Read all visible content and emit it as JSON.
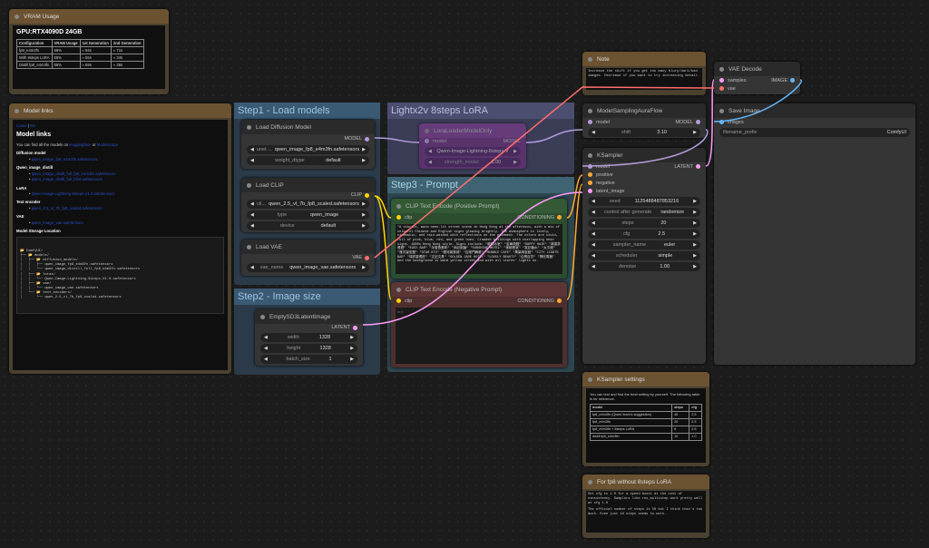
{
  "vram": {
    "title": "VRAM Usage",
    "gpu": "GPU:RTX4090D 24GB",
    "headers": [
      "Configuration",
      "VRAM Usage",
      "1st Generation",
      "2nd Generation"
    ],
    "rows": [
      [
        "fp8_e4m3fn",
        "86%",
        "≈ 94s",
        "≈ 71s"
      ],
      [
        "With 8steps LoRA",
        "86%",
        "≈ 55s",
        "≈ 34s"
      ],
      [
        "Distill fp8_e4m3fn",
        "86%",
        "≈ 69s",
        "≈ 36s"
      ]
    ]
  },
  "links": {
    "title": "Model links",
    "top_links": [
      "Loose",
      "|",
      "BS"
    ],
    "heading": "Model links",
    "intro_prefix": "You can find all the models on ",
    "intro_link1": "Huggingface",
    "intro_or": " or ",
    "intro_link2": "Modelscope",
    "sections": [
      {
        "label": "Diffusion model",
        "items": [
          "qwen_image_fp8_e4m3fn.safetensors"
        ]
      },
      {
        "label": "Qwen_image_distill",
        "items": [
          "qwen_image_distill_full_fp8_e4m3fn.safetensors",
          "qwen_image_distill_full_bf16.safetensors"
        ]
      },
      {
        "label": "LoRA",
        "items": [
          "Qwen-Image-Lightning-8steps-V1.0.safetensors"
        ]
      },
      {
        "label": "Text encoder",
        "items": [
          "qwen_2.5_vl_7b_fp8_scaled.safetensors"
        ]
      },
      {
        "label": "VAE",
        "items": [
          "qwen_image_vae.safetensors"
        ]
      }
    ],
    "storage_label": "Model Storage Location",
    "tree": [
      "📂 ComfyUI/",
      "├── 📂 models/",
      "│   ├── 📂 diffusion_models/",
      "│   │   ├── qwen_image_fp8_e4m3fn.safetensors",
      "│   │   └── qwen_image_distill_full_fp8_e4m3fn.safetensors",
      "│   ├── 📂 loras/",
      "│   │   └── Qwen-Image-Lightning-8steps-V1.0.safetensors",
      "│   ├── 📂 vae/",
      "│   │   └── qwen_image_vae.safetensors",
      "│   └── 📂 text_encoders/",
      "│       └── qwen_2.5_vl_7b_fp8_scaled.safetensors"
    ]
  },
  "groups": {
    "step1": "Step1 - Load models",
    "step2": "Step2 - Image size",
    "step3": "Step3 - Prompt",
    "lightx": "Lightx2v 8steps LoRA"
  },
  "load_diffusion": {
    "title": "Load Diffusion Model",
    "out": "MODEL",
    "unet_label": "unet ...",
    "unet_value": "qwen_image_fp8_e4m3fn.safetensors",
    "dtype_label": "weight_dtype",
    "dtype_value": "default"
  },
  "load_clip": {
    "title": "Load CLIP",
    "out": "CLIP",
    "name_label": "cli...",
    "name_value": "qwen_2.5_vl_7b_fp8_scaled.safetensors",
    "type_label": "type",
    "type_value": "qwen_image",
    "device_label": "device",
    "device_value": "default"
  },
  "load_vae": {
    "title": "Load VAE",
    "out": "VAE",
    "name_label": "vae_name",
    "name_value": "qwen_image_vae.safetensors"
  },
  "empty_latent": {
    "title": "EmptySD3LatentImage",
    "out": "LATENT",
    "width_label": "width",
    "width_value": "1328",
    "height_label": "height",
    "height_value": "1328",
    "batch_label": "batch_size",
    "batch_value": "1"
  },
  "lora": {
    "title": "LoraLoaderModelOnly",
    "in": "model",
    "out": "MODEL",
    "name_value": "Qwen-Image-Lightning-8steps-V",
    "strength_label": "strength_model",
    "strength_value": "1.00"
  },
  "pos": {
    "title": "CLIP Text Encode (Positive Prompt)",
    "in": "clip",
    "out": "CONDITIONING",
    "text": "\"A vibrant, warm neon-lit street scene in Hong Kong at the afternoon, with a mix of colorful Chinese and English signs glowing brightly. The atmosphere is lively, cinematic, and rain-washed with reflections on the pavement. The colors are vivid, full of pink, blue, red, and green hues. Crowded buildings with overlapping neon signs. 1980s Hong Kong style. Signs include: \"龍鳳冰室\" \"金華燒臘\" \"HAPPY HAIR\" \"鴻運茶餐廳\" \"EASY BAR\" \"永發魚蛋粉\" \"添記粥麵\" \"SUNSHINE MOTEL\" \"美都餐室\" \"富記糖水\" \"太平館\" \"雅芳髮型屋\" \"STAR KTV\" \"銀河娛樂城\" \"百樂門舞廳\" \"BUBBLE CAFE\" \"萬豪麻雀館\" \"CITY LIGHTS BAR\" \"瑞祥香燭莊\" \"文記文具\" \"GOLDEN JADE HOTEL\" \"LOVELY BEAUTY\" \"合興百貨\" \"興旺電器\" And the background is warm yellow street and with all stores' lights on."
  },
  "neg": {
    "title": "CLIP Text Encode (Negative Prompt)",
    "in": "clip",
    "out": "CONDITIONING",
    "placeholder": "text"
  },
  "note": {
    "title": "Note",
    "text": "Increase the shift if you get too many blury/dark/bad images. Decrease if you want to try increasing detail."
  },
  "sampling": {
    "title": "ModelSamplingAuraFlow",
    "in": "model",
    "out": "MODEL",
    "shift_label": "shift",
    "shift_value": "3.10"
  },
  "ksampler": {
    "title": "KSampler",
    "out": "LATENT",
    "inputs": [
      "model",
      "positive",
      "negative",
      "latent_image"
    ],
    "widgets": [
      {
        "label": "seed",
        "value": "1125488487853216"
      },
      {
        "label": "control after generate",
        "value": "randomize"
      },
      {
        "label": "steps",
        "value": "20"
      },
      {
        "label": "cfg",
        "value": "2.5"
      },
      {
        "label": "sampler_name",
        "value": "euler"
      },
      {
        "label": "scheduler",
        "value": "simple"
      },
      {
        "label": "denoise",
        "value": "1.00"
      }
    ]
  },
  "vae_decode": {
    "title": "VAE Decode",
    "in1": "samples",
    "in2": "vae",
    "out": "IMAGE"
  },
  "save": {
    "title": "Save Image",
    "in": "images",
    "prefix_label": "filename_prefix",
    "prefix_value": "ComfyUI"
  },
  "ks_settings": {
    "title": "KSampler settings",
    "intro": "You can test and find the best setting by yourself. The following table is for reference.",
    "headers": [
      "model",
      "steps",
      "cfg"
    ],
    "rows": [
      [
        "fp8_e4m3fn (Qwen team's suggestion)",
        "40",
        "2.5"
      ],
      [
        "fp8_e4m3fn",
        "20",
        "2.5"
      ],
      [
        "fp8_e4m3fn + 8steps LoRA",
        "8",
        "2.5"
      ],
      [
        "distill fp8_e4m3fn",
        "10",
        "1.0"
      ]
    ]
  },
  "fp8_note": {
    "title": "For fp8 without 8steps LoRA",
    "text1": "Set cfg to 1.0 for a speed boost at the cost of consistency. Samplers like res_multistep work pretty well at cfg 1.0",
    "text2": "The official number of steps is 50 but I think that's too much. Even just 10 steps seems to work."
  }
}
